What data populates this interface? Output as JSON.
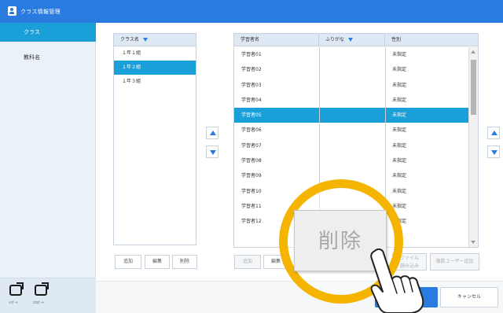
{
  "titlebar": {
    "title": "クラス情報管理"
  },
  "sidebar": {
    "items": [
      {
        "label": "クラス",
        "active": true
      },
      {
        "label": "教科名",
        "active": false
      }
    ],
    "bottom_labels": [
      "ｲﾝﾎﾟｰﾄ",
      "ｴｸｽﾎﾟｰﾄ"
    ]
  },
  "class_panel": {
    "header": "クラス名",
    "rows": [
      {
        "label": "１年１組",
        "selected": false
      },
      {
        "label": "１年２組",
        "selected": true
      },
      {
        "label": "１年３組",
        "selected": false
      }
    ],
    "buttons": {
      "add": "追加",
      "edit": "編集",
      "delete": "削除"
    }
  },
  "student_panel": {
    "headers": {
      "name": "学習者名",
      "kana": "ふりがな",
      "gender": "性別"
    },
    "rows": [
      {
        "name": "学習者01",
        "kana": "",
        "gender": "未指定",
        "selected": false
      },
      {
        "name": "学習者02",
        "kana": "",
        "gender": "未指定",
        "selected": false
      },
      {
        "name": "学習者03",
        "kana": "",
        "gender": "未指定",
        "selected": false
      },
      {
        "name": "学習者04",
        "kana": "",
        "gender": "未指定",
        "selected": false
      },
      {
        "name": "学習者05",
        "kana": "",
        "gender": "未指定",
        "selected": true
      },
      {
        "name": "学習者06",
        "kana": "",
        "gender": "未指定",
        "selected": false
      },
      {
        "name": "学習者07",
        "kana": "",
        "gender": "未指定",
        "selected": false
      },
      {
        "name": "学習者08",
        "kana": "",
        "gender": "未指定",
        "selected": false
      },
      {
        "name": "学習者09",
        "kana": "",
        "gender": "未指定",
        "selected": false
      },
      {
        "name": "学習者10",
        "kana": "",
        "gender": "未指定",
        "selected": false
      },
      {
        "name": "学習者11",
        "kana": "",
        "gender": "未指定",
        "selected": false
      },
      {
        "name": "学習者12",
        "kana": "",
        "gender": "未指定",
        "selected": false
      }
    ],
    "buttons": {
      "add": "追加",
      "edit": "編集",
      "file_import": "ファイル\n読み込み",
      "bulk_add": "複数ユーザー追加"
    }
  },
  "footer": {
    "ok": "OK",
    "cancel": "キャンセル"
  },
  "callout": {
    "label": "削除"
  },
  "colors": {
    "accent": "#2a7be0",
    "selection": "#1a9fd8",
    "highlight_ring": "#f5b400"
  }
}
